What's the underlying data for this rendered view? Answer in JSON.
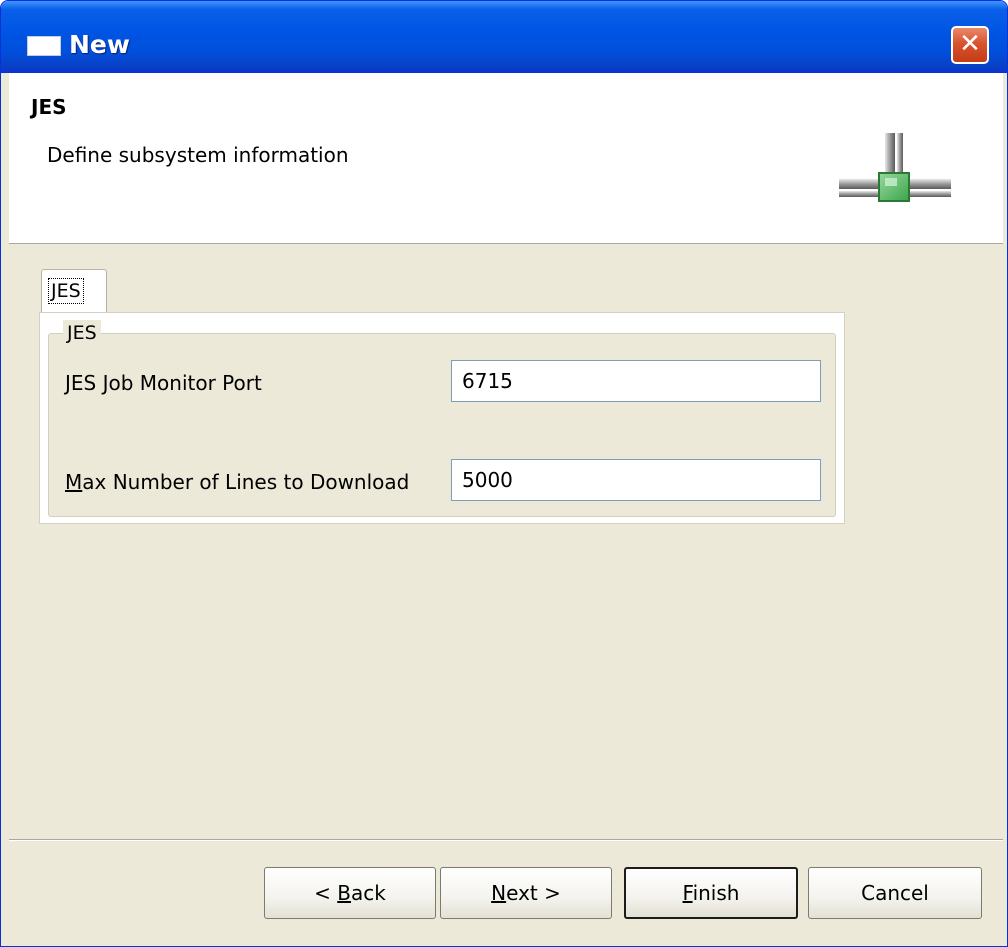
{
  "window": {
    "title": "New",
    "close_glyph": "✕",
    "title_icon": "window-icon"
  },
  "header": {
    "title": "JES",
    "description": "Define subsystem information",
    "icon": "subsystem-connector-icon"
  },
  "tabs": [
    {
      "label": "JES",
      "selected": true
    }
  ],
  "group": {
    "legend": "JES",
    "fields": [
      {
        "label_mnemonic": "J",
        "label_rest": "ES Job Monitor Port",
        "value": "6715"
      },
      {
        "label_mnemonic": "M",
        "label_rest": "ax Number of Lines to Download",
        "value": "5000"
      }
    ]
  },
  "buttons": {
    "back": {
      "prefix": "< ",
      "mnemonic": "B",
      "rest": "ack"
    },
    "next": {
      "mnemonic": "N",
      "rest": "ext >"
    },
    "finish": {
      "mnemonic": "F",
      "rest": "inish"
    },
    "cancel": {
      "label": "Cancel"
    }
  },
  "colors": {
    "title_bar": "#0054e3",
    "close_button": "#d9532f",
    "dialog_background": "#ece9d8",
    "connector_green": "#3aa64a"
  }
}
